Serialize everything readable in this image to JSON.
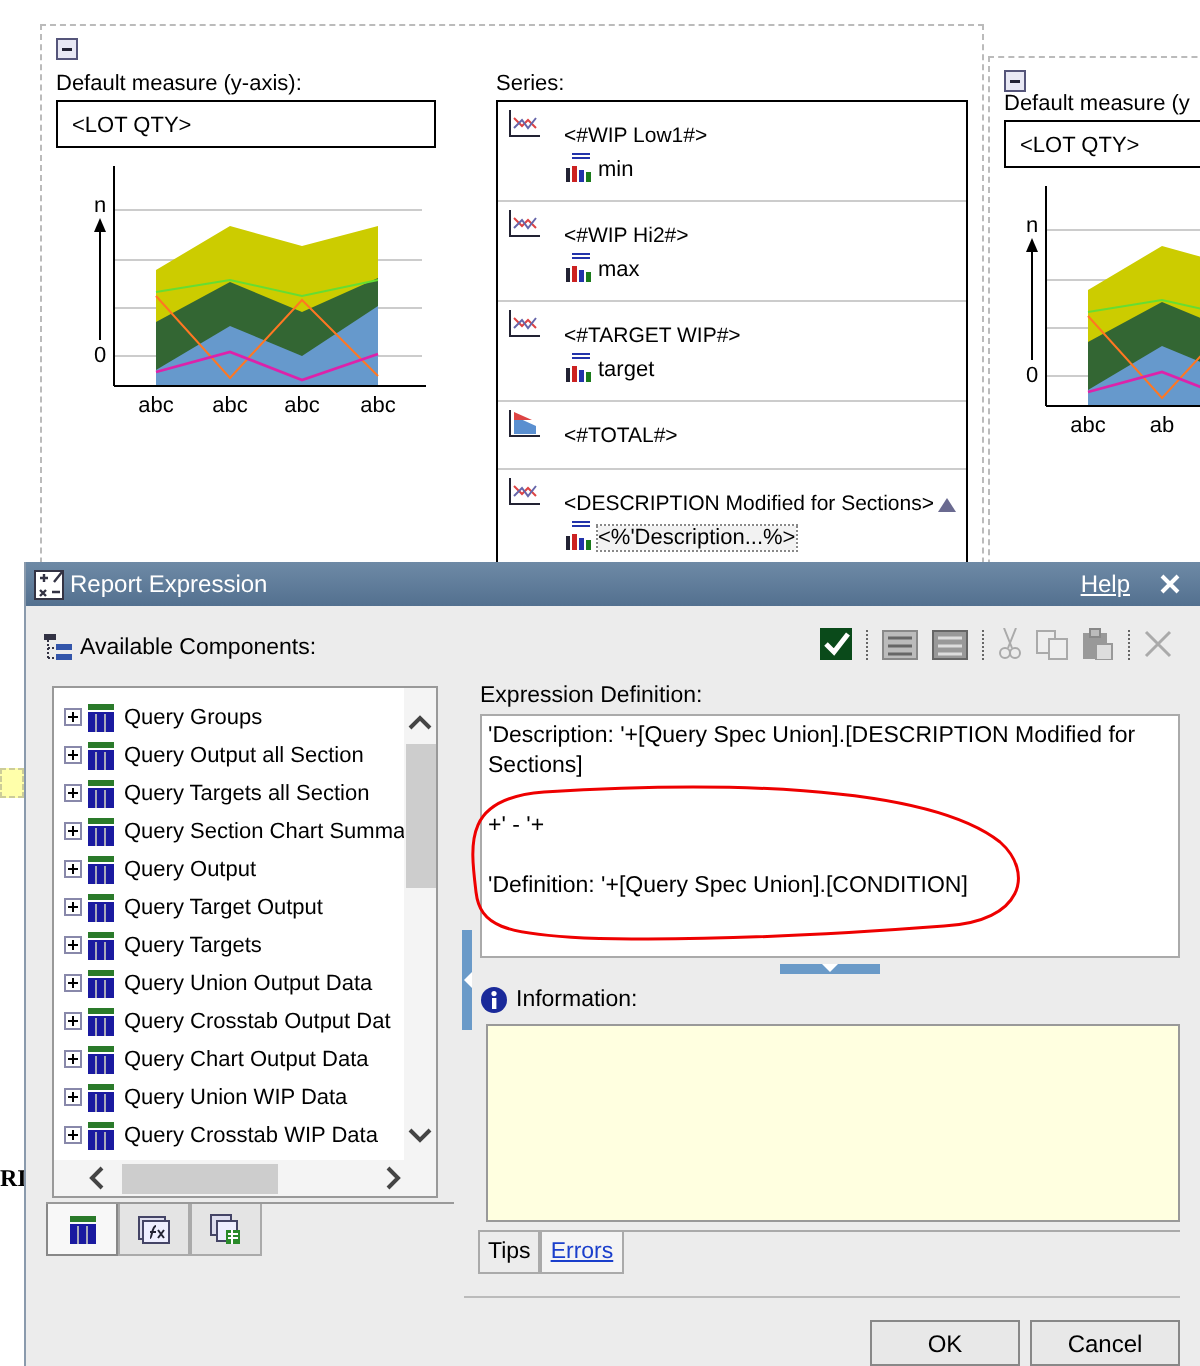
{
  "report": {
    "measure_label": "Default measure (y-axis):",
    "measure_value": "<LOT QTY>",
    "preview": {
      "y_labels": [
        "n",
        "0"
      ],
      "x_labels": [
        "abc",
        "abc",
        "abc",
        "abc"
      ]
    },
    "series_label": "Series:",
    "series": [
      {
        "kind": "line",
        "name": "<#WIP Low1#>",
        "item": "min",
        "sorted": false
      },
      {
        "kind": "line",
        "name": "<#WIP Hi2#>",
        "item": "max",
        "sorted": false
      },
      {
        "kind": "line",
        "name": "<#TARGET WIP#>",
        "item": "target",
        "sorted": false
      },
      {
        "kind": "total",
        "name": "<#TOTAL#>",
        "sorted": false
      },
      {
        "kind": "line",
        "name": "<DESCRIPTION Modified for Sections>",
        "item": "<%'Description...%>",
        "sorted": true
      }
    ]
  },
  "side_report": {
    "measure_label": "Default measure (y",
    "measure_value": "<LOT QTY>",
    "preview": {
      "y_labels": [
        "n",
        "0"
      ],
      "x_labels": [
        "abc",
        "ab"
      ]
    }
  },
  "background_fragment": "RI",
  "dialog": {
    "title": "Report Expression",
    "help": "Help",
    "components_label": "Available Components:",
    "components": [
      {
        "label": "Query Groups",
        "expanded": false
      },
      {
        "label": "Query Output all Section",
        "expanded": false
      },
      {
        "label": "Query Targets all Section",
        "expanded": false
      },
      {
        "label": "Query Section Chart Summa",
        "expanded": false
      },
      {
        "label": "Query Output",
        "expanded": false
      },
      {
        "label": "Query Target Output",
        "expanded": false
      },
      {
        "label": "Query Targets",
        "expanded": false
      },
      {
        "label": "Query Union Output Data",
        "expanded": false
      },
      {
        "label": "Query Crosstab Output Dat",
        "expanded": false
      },
      {
        "label": "Query Chart Output Data",
        "expanded": false
      },
      {
        "label": "Query Union WIP Data",
        "expanded": false
      },
      {
        "label": "Query Crosstab WIP Data",
        "expanded": false
      }
    ],
    "source_tabs": [
      {
        "kind": "data",
        "selected": true
      },
      {
        "kind": "functions",
        "selected": false
      },
      {
        "kind": "parameters",
        "selected": false
      }
    ],
    "expression_label": "Expression Definition:",
    "expression_lines": [
      "'Description: '+[Query Spec Union].[DESCRIPTION Modified for Sections]",
      "+' - '+",
      "'Definition: '+[Query Spec Union].[CONDITION]"
    ],
    "information_label": "Information:",
    "info_tabs": [
      {
        "label": "Tips",
        "selected": true
      },
      {
        "label": "Errors",
        "selected": false
      }
    ],
    "buttons": [
      "OK",
      "Cancel"
    ]
  }
}
